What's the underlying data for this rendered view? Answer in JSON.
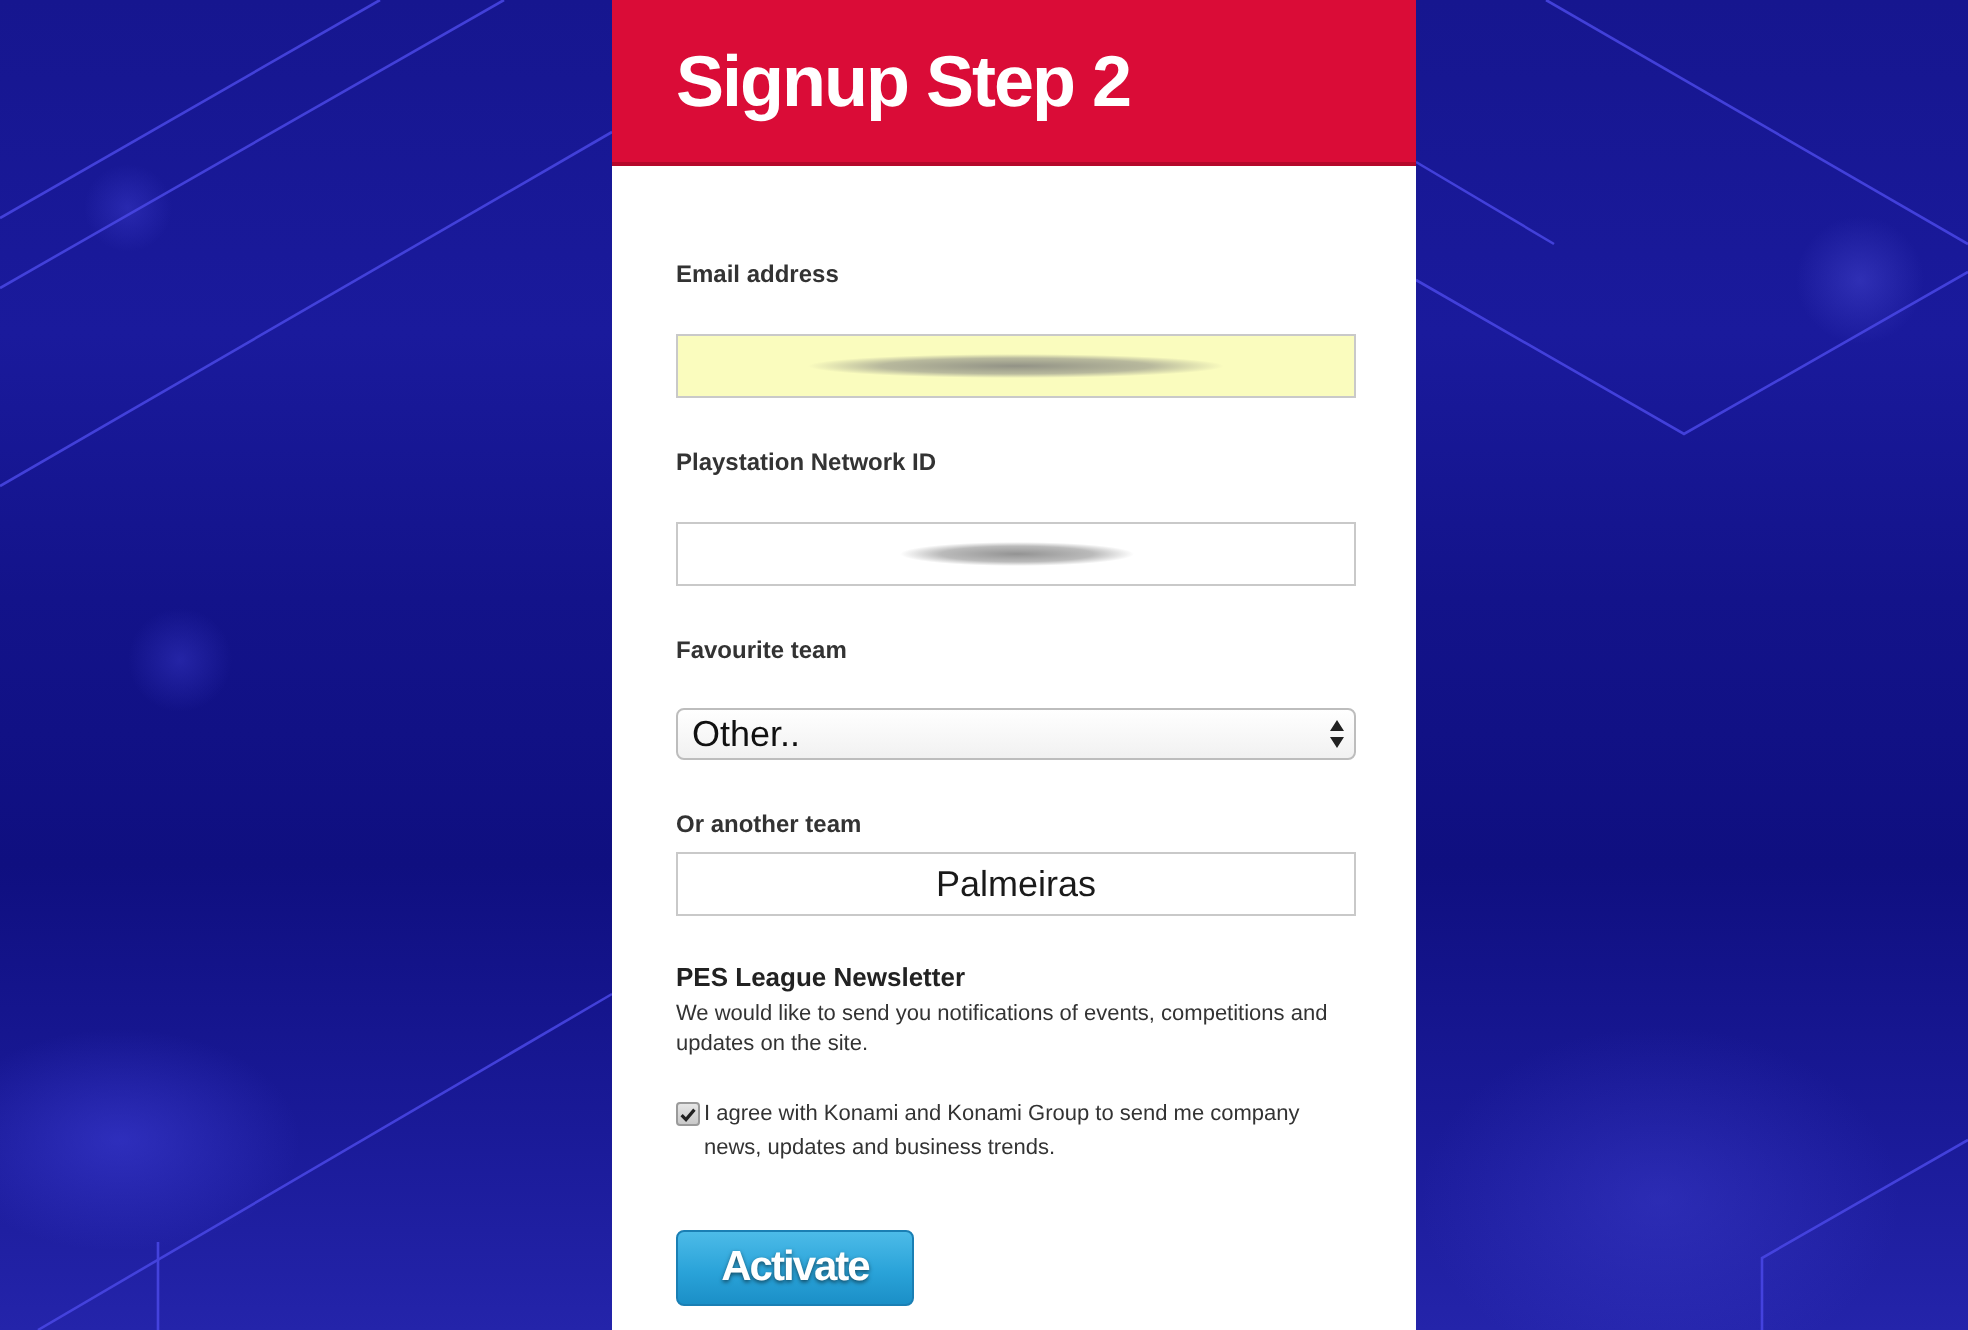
{
  "header": {
    "title": "Signup Step 2"
  },
  "fields": [
    {
      "kind": "input",
      "label": "Email address",
      "autofilled": true,
      "redacted": true
    },
    {
      "kind": "input",
      "label": "Playstation Network ID",
      "autofilled": false,
      "redacted": true
    },
    {
      "kind": "select",
      "label": "Favourite team",
      "value": "Other.."
    },
    {
      "kind": "input",
      "label": "Or another team",
      "autofilled": false,
      "redacted": false,
      "value": "Palmeiras"
    }
  ],
  "newsletter": {
    "title": "PES League Newsletter",
    "description": "We would like to send you notifications of events, competitions and updates on the site.",
    "agree": {
      "label": "I agree with Konami and Konami Group to send me company news, updates and business trends.",
      "checked": true
    }
  },
  "buttons": [
    {
      "kind": "primary",
      "label": "Activate"
    }
  ]
}
